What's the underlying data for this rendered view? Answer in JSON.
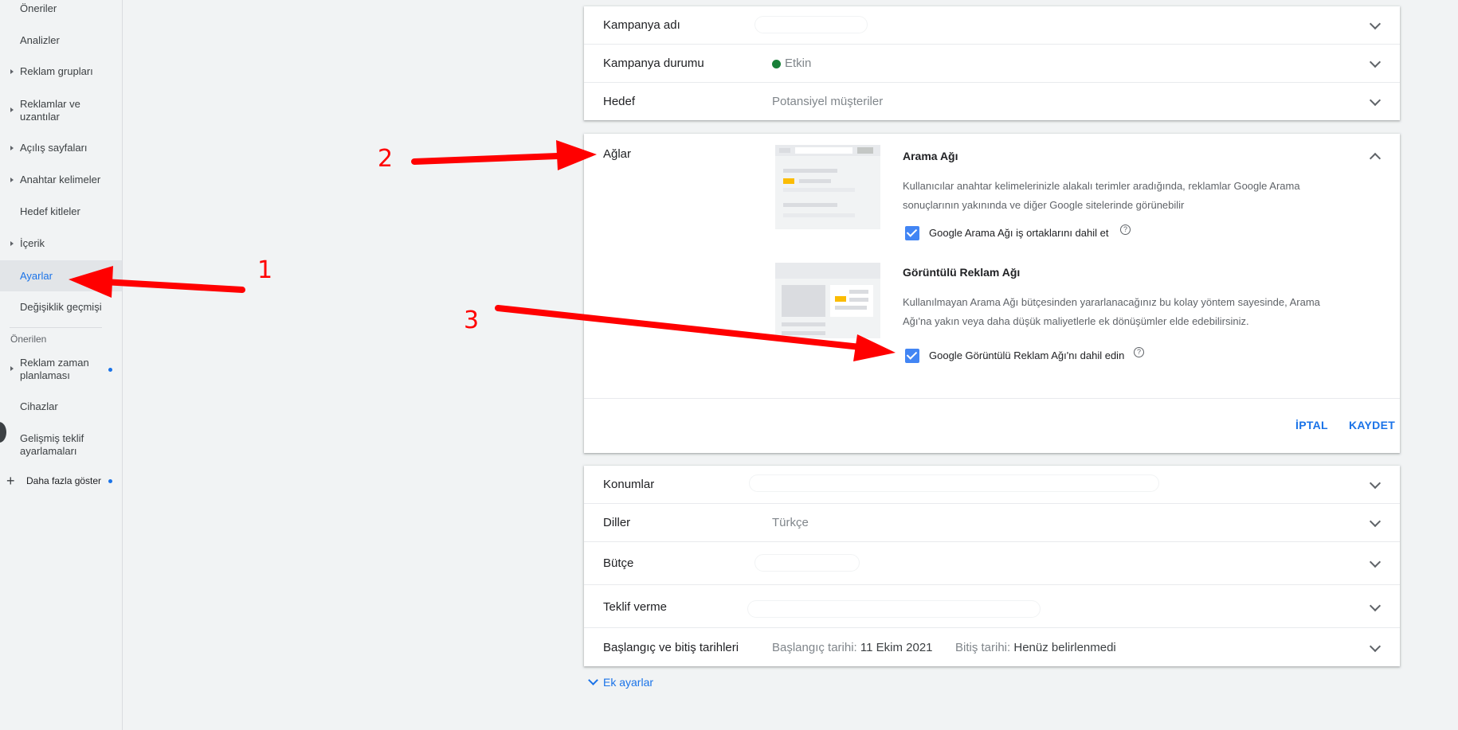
{
  "sidebar": {
    "items": [
      {
        "label": "Öneriler"
      },
      {
        "label": "Analizler"
      },
      {
        "label": "Reklam grupları"
      },
      {
        "label": "Reklamlar ve uzantılar"
      },
      {
        "label": "Açılış sayfaları"
      },
      {
        "label": "Anahtar kelimeler"
      },
      {
        "label": "Hedef kitleler"
      },
      {
        "label": "İçerik"
      },
      {
        "label": "Ayarlar"
      },
      {
        "label": "Değişiklik geçmişi"
      }
    ],
    "section_label": "Önerilen",
    "recommended": [
      {
        "label": "Reklam zaman planlaması"
      },
      {
        "label": "Cihazlar"
      },
      {
        "label": "Gelişmiş teklif ayarlamaları"
      }
    ],
    "show_more": "Daha fazla göster"
  },
  "top_card": {
    "rows": [
      {
        "label": "Kampanya adı",
        "value": ""
      },
      {
        "label": "Kampanya durumu",
        "value": "Etkin"
      },
      {
        "label": "Hedef",
        "value": "Potansiyel müşteriler"
      }
    ]
  },
  "networks": {
    "label": "Ağlar",
    "search": {
      "title": "Arama Ağı",
      "description": "Kullanıcılar anahtar kelimelerinizle alakalı terimler aradığında, reklamlar Google Arama sonuçlarının yakınında ve diğer Google sitelerinde görünebilir",
      "checkbox_label": "Google Arama Ağı iş ortaklarını dahil et",
      "checked": true
    },
    "display": {
      "title": "Görüntülü Reklam Ağı",
      "description": "Kullanılmayan Arama Ağı bütçesinden yararlanacağınız bu kolay yöntem sayesinde, Arama Ağı'na yakın veya daha düşük maliyetlerle ek dönüşümler elde edebilirsiniz.",
      "checkbox_label": "Google Görüntülü Reklam Ağı'nı dahil edin",
      "checked": true
    },
    "help_glyph": "?",
    "cancel_label": "İPTAL",
    "save_label": "KAYDET"
  },
  "bottom_card": {
    "rows": [
      {
        "label": "Konumlar",
        "value": ""
      },
      {
        "label": "Diller",
        "value": "Türkçe"
      },
      {
        "label": "Bütçe",
        "value": ""
      },
      {
        "label": "Teklif verme",
        "value": ""
      },
      {
        "label": "Başlangıç ve bitiş tarihleri"
      }
    ],
    "dates": {
      "start_label": "Başlangıç tarihi:",
      "start_value": "11 Ekim 2021",
      "end_label": "Bitiş tarihi:",
      "end_value": "Henüz belirlenmedi"
    }
  },
  "extra_settings": "Ek ayarlar",
  "annotations": [
    "1",
    "2",
    "3"
  ],
  "colors": {
    "accent": "#1a73e8",
    "status_active": "#188038",
    "arrow": "#ff0000",
    "checkbox": "#4285f4"
  }
}
